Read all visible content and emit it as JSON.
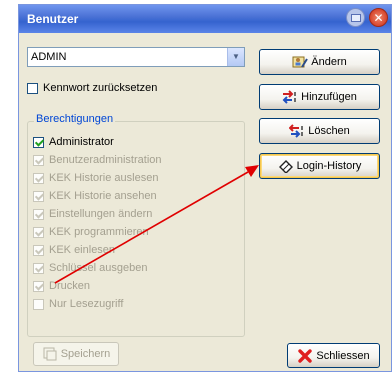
{
  "window": {
    "title": "Benutzer"
  },
  "user_select": {
    "value": "ADMIN"
  },
  "reset_password": {
    "label": "Kennwort zurücksetzen",
    "checked": false
  },
  "permissions": {
    "legend": "Berechtigungen",
    "items": [
      {
        "label": "Administrator",
        "checked": true,
        "enabled": true
      },
      {
        "label": "Benutzeradministration",
        "checked": true,
        "enabled": false
      },
      {
        "label": "KEK Historie auslesen",
        "checked": true,
        "enabled": false
      },
      {
        "label": "KEK Historie ansehen",
        "checked": true,
        "enabled": false
      },
      {
        "label": "Einstellungen ändern",
        "checked": true,
        "enabled": false
      },
      {
        "label": "KEK programmieren",
        "checked": true,
        "enabled": false
      },
      {
        "label": "KEK einlesen",
        "checked": true,
        "enabled": false
      },
      {
        "label": "Schlüssel ausgeben",
        "checked": true,
        "enabled": false
      },
      {
        "label": "Drucken",
        "checked": true,
        "enabled": false
      },
      {
        "label": "Nur Lesezugriff",
        "checked": false,
        "enabled": false
      }
    ]
  },
  "buttons": {
    "change": "Ändern",
    "add": "Hinzufügen",
    "delete": "Löschen",
    "login_history": "Login-History",
    "save": "Speichern",
    "close": "Schliessen"
  },
  "colors": {
    "titlebar": "#3563cf",
    "window_bg": "#ece9d8",
    "group_legend": "#0046d5",
    "annotation_arrow": "#e00000"
  }
}
